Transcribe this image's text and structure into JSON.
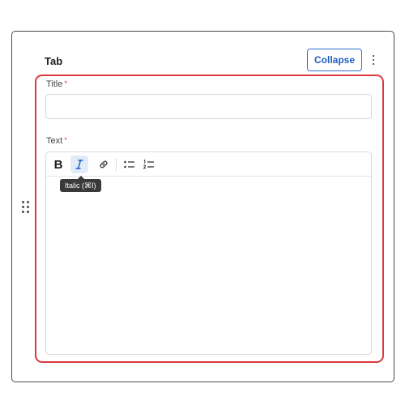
{
  "card": {
    "title": "Tab",
    "collapse_label": "Collapse",
    "more_icon": "kebab-menu-icon",
    "drag_icon": "drag-handle-icon"
  },
  "fields": {
    "title": {
      "label": "Title",
      "required_mark": "*",
      "value": ""
    },
    "text": {
      "label": "Text",
      "required_mark": "*",
      "value": "",
      "toolbar": {
        "bold_label": "B",
        "italic_icon": "italic-icon",
        "link_icon": "link-icon",
        "bullet_list_icon": "bullet-list-icon",
        "ordered_list_icon": "ordered-list-icon",
        "tooltip": "Italic (⌘I)"
      }
    }
  },
  "colors": {
    "accent": "#2f6fd6",
    "required": "#d93a3a",
    "highlight_border": "#d93a3a",
    "active_button_bg": "#e3ebf9"
  }
}
